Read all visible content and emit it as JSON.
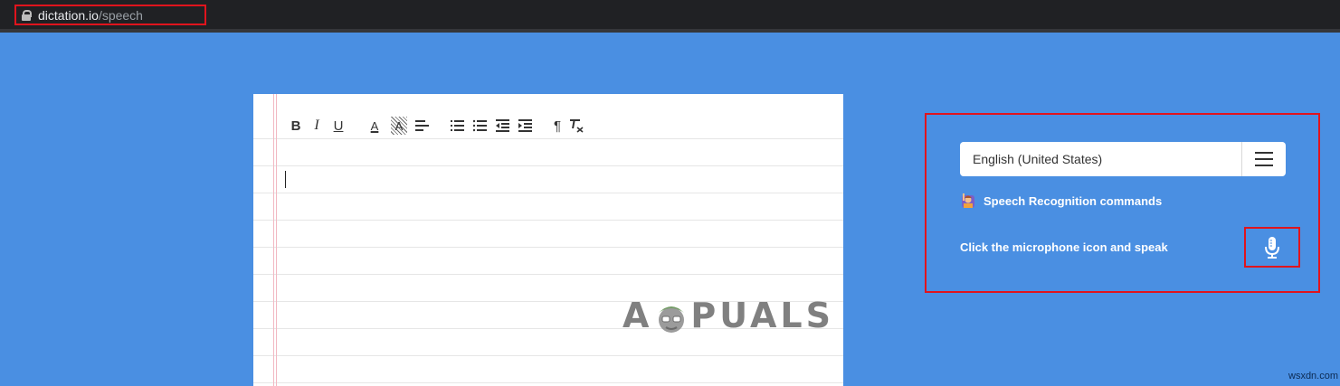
{
  "browser": {
    "url_domain": "dictation.io",
    "url_path": "/speech",
    "lock_icon": "lock-icon"
  },
  "editor": {
    "toolbar": {
      "bold": "B",
      "italic": "I",
      "underline": "U",
      "text_color": "A",
      "highlight": "A",
      "paragraph": "¶"
    }
  },
  "watermark": {
    "left": "A",
    "right": "PUALS"
  },
  "panel": {
    "language": "English (United States)",
    "commands_label": "Speech Recognition commands",
    "speak_prompt": "Click the microphone icon and speak"
  },
  "footer": {
    "site": "wsxdn.com"
  },
  "colors": {
    "page_bg": "#4a8fe2",
    "highlight_border": "#e0141d"
  }
}
